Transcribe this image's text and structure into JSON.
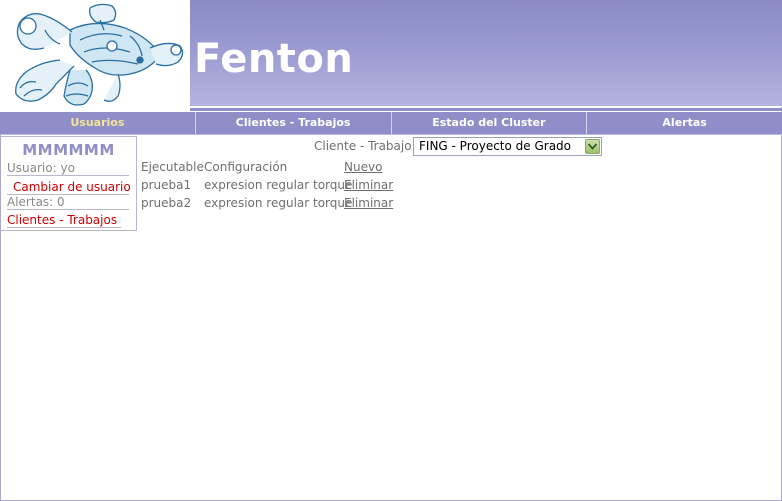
{
  "header": {
    "app_title": "Fenton",
    "logo_icon": "fenton-robot-logo"
  },
  "nav": {
    "tabs": [
      {
        "label": "Usuarios",
        "active": true
      },
      {
        "label": "Clientes - Trabajos",
        "active": false
      },
      {
        "label": "Estado del Cluster",
        "active": false
      },
      {
        "label": "Alertas",
        "active": false
      }
    ]
  },
  "userbox": {
    "name": "MMMMMM",
    "user_line": "Usuario: yo",
    "change_user_link": "Cambiar de usuario",
    "alerts_line": "Alertas: 0",
    "clients_link": "Clientes - Trabajos"
  },
  "filter": {
    "label": "Cliente - Trabajo:",
    "selected": "FING - Proyecto de Grado"
  },
  "table": {
    "headers": [
      "Ejecutable",
      "Configuración"
    ],
    "new_link": "Nuevo",
    "rows": [
      {
        "ejecutable": "prueba1",
        "configuracion": "expresion regular torque",
        "action": "Eliminar"
      },
      {
        "ejecutable": "prueba2",
        "configuracion": "expresion regular torque",
        "action": "Eliminar"
      }
    ]
  },
  "colors": {
    "nav_background": "#8f8ec9",
    "active_tab": "#f3e39a",
    "link_red": "#cc0000",
    "text_gray": "#6f6f6f"
  }
}
